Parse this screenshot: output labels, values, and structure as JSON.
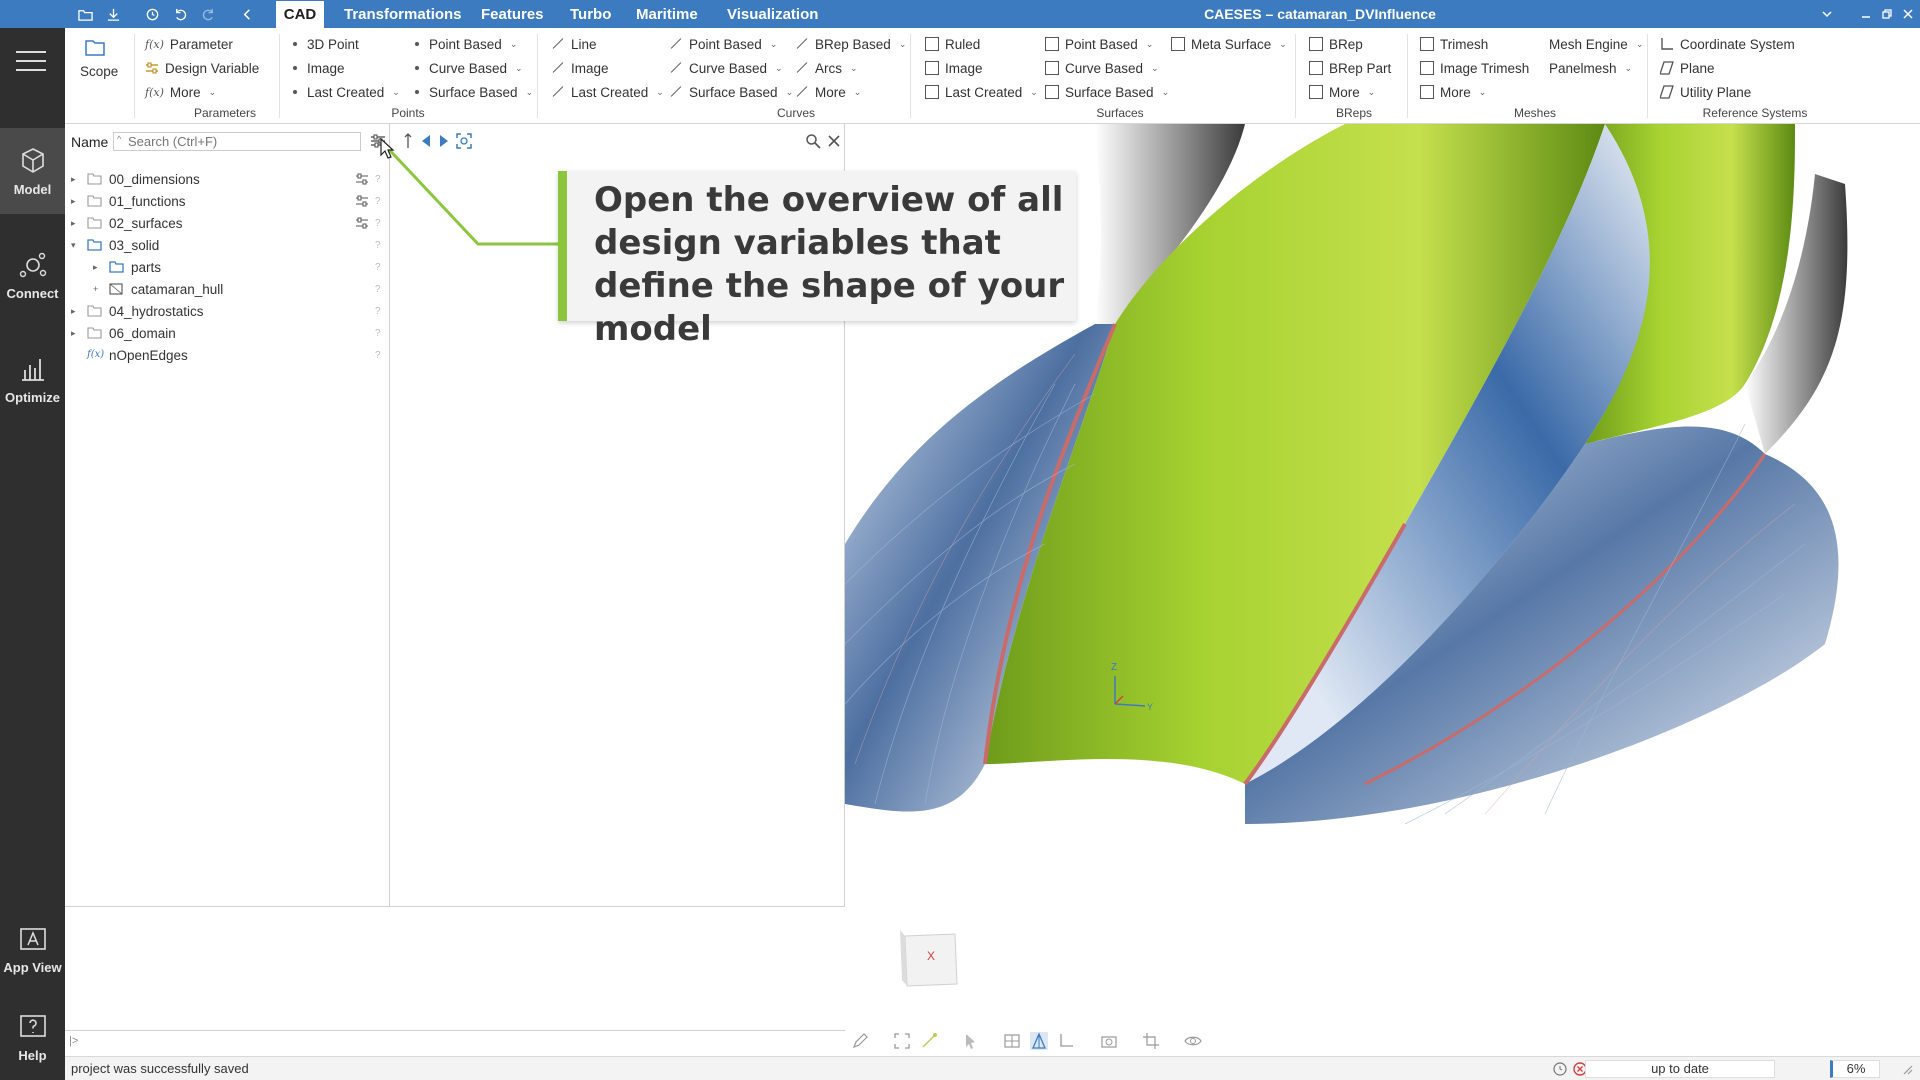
{
  "window": {
    "title": "CAESES – catamaran_DVInfluence"
  },
  "tabs": [
    {
      "label": "CAD",
      "active": true
    },
    {
      "label": "Transformations"
    },
    {
      "label": "Features"
    },
    {
      "label": "Turbo"
    },
    {
      "label": "Maritime"
    },
    {
      "label": "Visualization"
    }
  ],
  "sidebar": {
    "items": [
      {
        "label": "Model",
        "icon": "cube-icon",
        "active": true
      },
      {
        "label": "Connect",
        "icon": "connect-icon"
      },
      {
        "label": "Optimize",
        "icon": "optimize-icon"
      },
      {
        "label": "App View",
        "icon": "app-view-icon"
      },
      {
        "label": "Help",
        "icon": "help-icon"
      }
    ]
  },
  "ribbon": {
    "scope": "Scope",
    "parameters": {
      "group": "Parameters",
      "items": [
        "Parameter",
        "Design Variable",
        "More"
      ]
    },
    "points": {
      "group": "Points",
      "col1": [
        "3D Point",
        "Image",
        "Last Created"
      ],
      "col2": [
        "Point Based",
        "Curve Based",
        "Surface Based"
      ]
    },
    "curves": {
      "group": "Curves",
      "col1": [
        "Line",
        "Image",
        "Last Created"
      ],
      "col2": [
        "Point Based",
        "Curve Based",
        "Surface Based"
      ],
      "col3": [
        "BRep Based",
        "Arcs",
        "More"
      ]
    },
    "surfaces": {
      "group": "Surfaces",
      "col1": [
        "Ruled",
        "Image",
        "Last Created"
      ],
      "col2": [
        "Point Based",
        "Curve Based",
        "Surface Based"
      ],
      "col3": [
        "Meta Surface"
      ]
    },
    "breps": {
      "group": "BReps",
      "items": [
        "BRep",
        "BRep Part",
        "More"
      ]
    },
    "meshes": {
      "group": "Meshes",
      "col1": [
        "Trimesh",
        "Image Trimesh",
        "More"
      ],
      "col2": [
        "Mesh Engine",
        "Panelmesh"
      ]
    },
    "refsys": {
      "group": "Reference Systems",
      "items": [
        "Coordinate System",
        "Plane",
        "Utility Plane"
      ]
    }
  },
  "tree": {
    "name_label": "Name",
    "search_placeholder": "Search (Ctrl+F)",
    "rows": [
      {
        "label": "00_dimensions"
      },
      {
        "label": "01_functions"
      },
      {
        "label": "02_surfaces"
      },
      {
        "label": "03_solid"
      },
      {
        "label": "parts"
      },
      {
        "label": "catamaran_hull"
      },
      {
        "label": "04_hydrostatics"
      },
      {
        "label": "06_domain"
      },
      {
        "label": "nOpenEdges"
      }
    ]
  },
  "callout": {
    "text": "Open the overview of all design variables that define the shape of your model"
  },
  "console": {
    "prompt": "|>"
  },
  "status": {
    "message": "project was successfully saved",
    "state": "up to date",
    "zoom": "6%"
  },
  "axes": {
    "z": "Z",
    "y": "Y",
    "cube_label": "X"
  },
  "colors": {
    "accent": "#3c7bbf",
    "sidebar": "#2f2f2f",
    "callout_bar": "#8cc63f"
  }
}
